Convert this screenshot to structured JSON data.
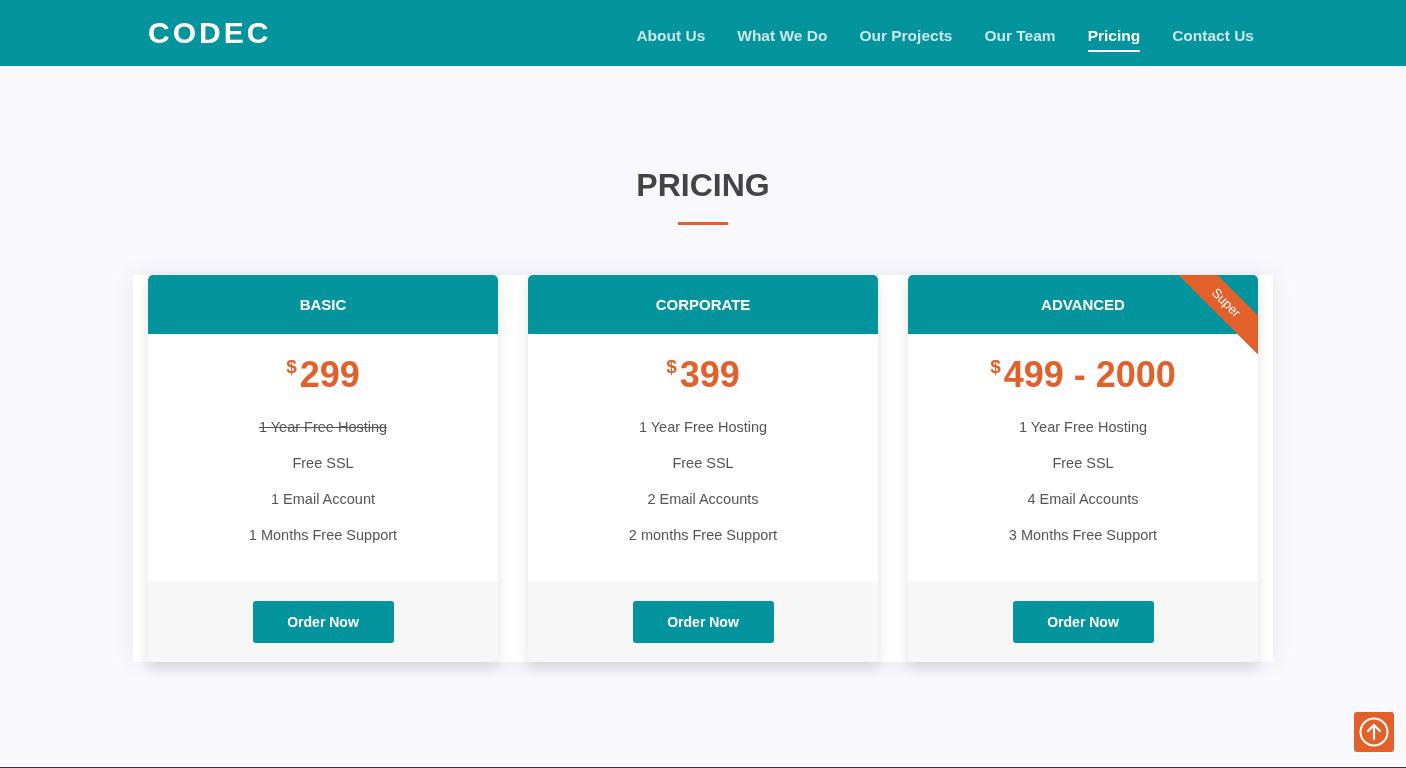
{
  "header": {
    "logo": "CODEC",
    "nav": [
      {
        "label": "About Us",
        "selected": false
      },
      {
        "label": "What We Do",
        "selected": false
      },
      {
        "label": "Our Projects",
        "selected": false
      },
      {
        "label": "Our Team",
        "selected": false
      },
      {
        "label": "Pricing",
        "selected": true
      },
      {
        "label": "Contact Us",
        "selected": false
      }
    ]
  },
  "section": {
    "title": "PRICING"
  },
  "plans": [
    {
      "name": "BASIC",
      "currency": "$",
      "amount": "299",
      "features": [
        {
          "text": "1 Year Free Hosting",
          "struck": true
        },
        {
          "text": "Free SSL",
          "struck": false
        },
        {
          "text": "1 Email Account",
          "struck": false
        },
        {
          "text": "1 Months Free Support",
          "struck": false
        }
      ],
      "button": "Order Now"
    },
    {
      "name": "CORPORATE",
      "currency": "$",
      "amount": "399",
      "features": [
        {
          "text": "1 Year Free Hosting",
          "struck": false
        },
        {
          "text": "Free SSL",
          "struck": false
        },
        {
          "text": "2 Email Accounts",
          "struck": false
        },
        {
          "text": "2 months Free Support",
          "struck": false
        }
      ],
      "button": "Order Now"
    },
    {
      "name": "ADVANCED",
      "ribbon": "Super",
      "currency": "$",
      "amount": "499 - 2000",
      "features": [
        {
          "text": "1 Year Free Hosting",
          "struck": false
        },
        {
          "text": "Free SSL",
          "struck": false
        },
        {
          "text": "4 Email Accounts",
          "struck": false
        },
        {
          "text": "3 Months Free Support",
          "struck": false
        }
      ],
      "button": "Order Now"
    }
  ]
}
